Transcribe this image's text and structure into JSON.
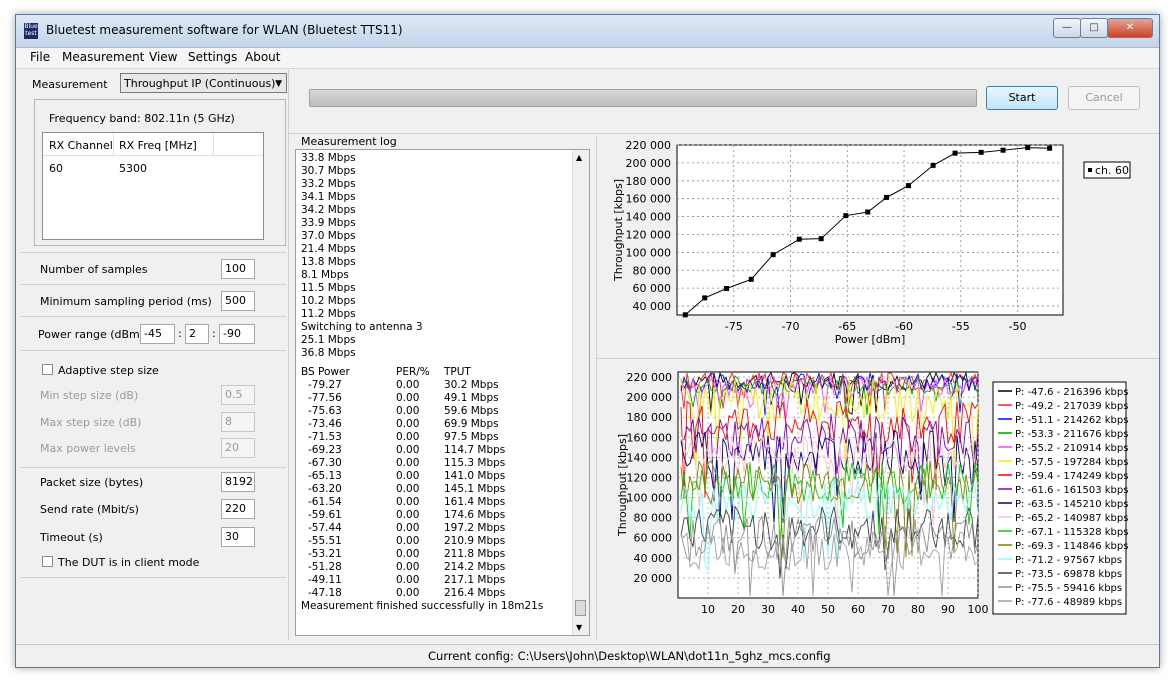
{
  "window": {
    "title": "Bluetest measurement software for WLAN (Bluetest TTS11)",
    "icon_text": "Blue test",
    "min_label": "—",
    "max_label": "□",
    "close_label": "✕"
  },
  "menu": [
    "File",
    "Measurement",
    "View",
    "Settings",
    "About"
  ],
  "measurement": {
    "label": "Measurement",
    "selected": "Throughput IP (Continuous)"
  },
  "frequency_band": "Frequency band: 802.11n (5 GHz)",
  "channel_table": {
    "headers": [
      "RX Channel",
      "RX Freq [MHz]"
    ],
    "rows": [
      [
        "60",
        "5300"
      ]
    ]
  },
  "settings": {
    "samples": {
      "label": "Number of samples",
      "value": "100"
    },
    "min_period": {
      "label": "Minimum sampling period (ms)",
      "value": "500"
    },
    "power_range": {
      "label": "Power range (dBm)",
      "start": "-45",
      "step": "2",
      "stop": "-90"
    },
    "adaptive": {
      "label": "Adaptive step size",
      "checked": false
    },
    "min_step": {
      "label": "Min step size (dB)",
      "value": "0.5"
    },
    "max_step": {
      "label": "Max step size (dB)",
      "value": "8"
    },
    "max_levels": {
      "label": "Max power levels",
      "value": "20"
    },
    "packet_size": {
      "label": "Packet size (bytes)",
      "value": "8192"
    },
    "send_rate": {
      "label": "Send rate (Mbit/s)",
      "value": "220"
    },
    "timeout": {
      "label": "Timeout (s)",
      "value": "30"
    },
    "client_mode": {
      "label": "The DUT is in client mode",
      "checked": false
    }
  },
  "progress_value": 1.0,
  "buttons": {
    "start": "Start",
    "cancel": "Cancel"
  },
  "log": {
    "title": "Measurement log",
    "lines": [
      "33.8 Mbps",
      "30.7 Mbps",
      "33.2 Mbps",
      "34.1 Mbps",
      "34.2 Mbps",
      "33.9 Mbps",
      "37.0 Mbps",
      "21.4 Mbps",
      "13.8 Mbps",
      "8.1 Mbps",
      "11.5 Mbps",
      "10.2 Mbps",
      "11.2 Mbps",
      "Switching to antenna 3",
      "25.1 Mbps",
      "36.8 Mbps"
    ],
    "table_headers": [
      "BS Power",
      "PER/%",
      "TPUT"
    ],
    "table_rows": [
      [
        "-79.27",
        "0.00",
        "30.2 Mbps"
      ],
      [
        "-77.56",
        "0.00",
        "49.1 Mbps"
      ],
      [
        "-75.63",
        "0.00",
        "59.6 Mbps"
      ],
      [
        "-73.46",
        "0.00",
        "69.9 Mbps"
      ],
      [
        "-71.53",
        "0.00",
        "97.5 Mbps"
      ],
      [
        "-69.23",
        "0.00",
        "114.7 Mbps"
      ],
      [
        "-67.30",
        "0.00",
        "115.3 Mbps"
      ],
      [
        "-65.13",
        "0.00",
        "141.0 Mbps"
      ],
      [
        "-63.20",
        "0.00",
        "145.1 Mbps"
      ],
      [
        "-61.54",
        "0.00",
        "161.4 Mbps"
      ],
      [
        "-59.61",
        "0.00",
        "174.6 Mbps"
      ],
      [
        "-57.44",
        "0.00",
        "197.2 Mbps"
      ],
      [
        "-55.51",
        "0.00",
        "210.9 Mbps"
      ],
      [
        "-53.21",
        "0.00",
        "211.8 Mbps"
      ],
      [
        "-51.28",
        "0.00",
        "214.2 Mbps"
      ],
      [
        "-49.11",
        "0.00",
        "217.1 Mbps"
      ],
      [
        "-47.18",
        "0.00",
        "216.4 Mbps"
      ]
    ],
    "footer": "Measurement finished successfully in 18m21s"
  },
  "chart_data": [
    {
      "type": "line",
      "xlabel": "Power [dBm]",
      "ylabel": "Throughput [kbps]",
      "xlim": [
        -80,
        -46
      ],
      "ylim": [
        30000,
        220000
      ],
      "xticks": [
        -75,
        -70,
        -65,
        -60,
        -55,
        -50
      ],
      "yticks": [
        40000,
        60000,
        80000,
        100000,
        120000,
        140000,
        160000,
        180000,
        200000,
        220000
      ],
      "ytick_labels": [
        "40 000",
        "60 000",
        "80 000",
        "100 000",
        "120 000",
        "140 000",
        "160 000",
        "180 000",
        "200 000",
        "220 000"
      ],
      "grid": true,
      "series": [
        {
          "name": "ch. 60",
          "color": "#000000",
          "x": [
            -79.27,
            -77.56,
            -75.63,
            -73.46,
            -71.53,
            -69.23,
            -67.3,
            -65.13,
            -63.2,
            -61.54,
            -59.61,
            -57.44,
            -55.51,
            -53.21,
            -51.28,
            -49.11,
            -47.18
          ],
          "y": [
            30200,
            49100,
            59600,
            69900,
            97500,
            114700,
            115300,
            141000,
            145100,
            161400,
            174600,
            197200,
            210900,
            211800,
            214200,
            217100,
            216400
          ]
        }
      ],
      "legend": "right"
    },
    {
      "type": "line",
      "xlabel": "",
      "ylabel": "Throughput [kbps]",
      "xlim": [
        0,
        100
      ],
      "ylim": [
        0,
        225000
      ],
      "xticks": [
        10,
        20,
        30,
        40,
        50,
        60,
        70,
        80,
        90,
        100
      ],
      "yticks": [
        20000,
        40000,
        60000,
        80000,
        100000,
        120000,
        140000,
        160000,
        180000,
        200000,
        220000
      ],
      "ytick_labels": [
        "20 000",
        "40 000",
        "60 000",
        "80 000",
        "100 000",
        "120 000",
        "140 000",
        "160 000",
        "180 000",
        "200 000",
        "220 000"
      ],
      "grid": true,
      "legend": "right",
      "series": [
        {
          "name": "P: -47.6 - 216396 kbps",
          "color": "#000000",
          "mean": 216396
        },
        {
          "name": "P: -49.2 - 217039 kbps",
          "color": "#ff2020",
          "mean": 217039
        },
        {
          "name": "P: -51.1 - 214262 kbps",
          "color": "#0000ff",
          "mean": 214262
        },
        {
          "name": "P: -53.3 - 211676 kbps",
          "color": "#00a000",
          "mean": 211676
        },
        {
          "name": "P: -55.2 - 210914 kbps",
          "color": "#ff40ff",
          "mean": 210914
        },
        {
          "name": "P: -57.5 - 197284 kbps",
          "color": "#f0f000",
          "mean": 197284
        },
        {
          "name": "P: -59.4 - 174249 kbps",
          "color": "#ff0000",
          "mean": 174249
        },
        {
          "name": "P: -61.6 - 161503 kbps",
          "color": "#8000c0",
          "mean": 161503
        },
        {
          "name": "P: -63.5 - 145210 kbps",
          "color": "#000080",
          "mean": 145210
        },
        {
          "name": "P: -65.2 - 140987 kbps",
          "color": "#ffc0c0",
          "mean": 140987
        },
        {
          "name": "P: -67.1 - 115328 kbps",
          "color": "#00d000",
          "mean": 115328
        },
        {
          "name": "P: -69.3 - 114846 kbps",
          "color": "#808000",
          "mean": 114846
        },
        {
          "name": "P: -71.2 - 97567 kbps",
          "color": "#80ffff",
          "mean": 97567
        },
        {
          "name": "P: -73.5 - 69878 kbps",
          "color": "#404040",
          "mean": 69878
        },
        {
          "name": "P: -75.5 - 59416 kbps",
          "color": "#909090",
          "mean": 59416
        },
        {
          "name": "P: -77.6 - 48989 kbps",
          "color": "#a0a0a0",
          "mean": 48989
        }
      ]
    }
  ],
  "status": "Current config: C:\\Users\\John\\Desktop\\WLAN\\dot11n_5ghz_mcs.config"
}
